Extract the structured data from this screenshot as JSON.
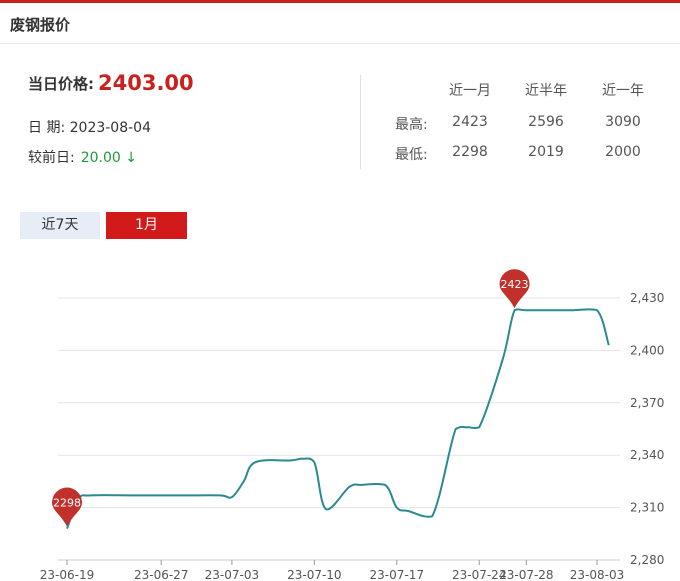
{
  "header": {
    "title": "废钢报价"
  },
  "summary": {
    "price_label": "当日价格:",
    "price_value": "2403.00",
    "date_label": "日 期:",
    "date_value": "2023-08-04",
    "change_label": "较前日:",
    "change_value": "20.00 ↓"
  },
  "stats": {
    "headers": [
      "近一月",
      "近半年",
      "近一年"
    ],
    "rows": [
      {
        "label": "最高:",
        "values": [
          "2423",
          "2596",
          "3090"
        ]
      },
      {
        "label": "最低:",
        "values": [
          "2298",
          "2019",
          "2000"
        ]
      }
    ]
  },
  "tabs": [
    {
      "label": "近7天",
      "active": false
    },
    {
      "label": "1月",
      "active": true
    }
  ],
  "colors": {
    "accent": "#c9211e",
    "line": "#2a8a8f",
    "down": "#1e9a3a"
  },
  "chart_data": {
    "type": "line",
    "x_tick_labels": [
      "23-06-19",
      "23-06-27",
      "23-07-03",
      "23-07-10",
      "23-07-17",
      "23-07-24",
      "23-07-28",
      "23-08-03"
    ],
    "y_tick_labels": [
      "2,280",
      "2,310",
      "2,340",
      "2,370",
      "2,400",
      "2,430"
    ],
    "ylim": [
      2280,
      2430
    ],
    "x": [
      "2023-06-19",
      "2023-06-20",
      "2023-06-21",
      "2023-06-25",
      "2023-06-29",
      "2023-07-02",
      "2023-07-03",
      "2023-07-04",
      "2023-07-05",
      "2023-07-08",
      "2023-07-09",
      "2023-07-10",
      "2023-07-11",
      "2023-07-13",
      "2023-07-14",
      "2023-07-16",
      "2023-07-17",
      "2023-07-18",
      "2023-07-20",
      "2023-07-22",
      "2023-07-23",
      "2023-07-24",
      "2023-07-26",
      "2023-07-27",
      "2023-07-28",
      "2023-07-31",
      "2023-08-01",
      "2023-08-03",
      "2023-08-04"
    ],
    "values": [
      2298,
      2315,
      2317,
      2317,
      2317,
      2317,
      2316,
      2325,
      2336,
      2337,
      2338,
      2336,
      2309,
      2322,
      2323,
      2323,
      2310,
      2308,
      2305,
      2355,
      2356,
      2356,
      2395,
      2423,
      2423,
      2423,
      2423,
      2423,
      2403
    ],
    "markers": [
      {
        "label": "2298",
        "x": "2023-06-19",
        "y": 2298
      },
      {
        "label": "2423",
        "x": "2023-07-27",
        "y": 2423
      }
    ],
    "grid": true
  }
}
